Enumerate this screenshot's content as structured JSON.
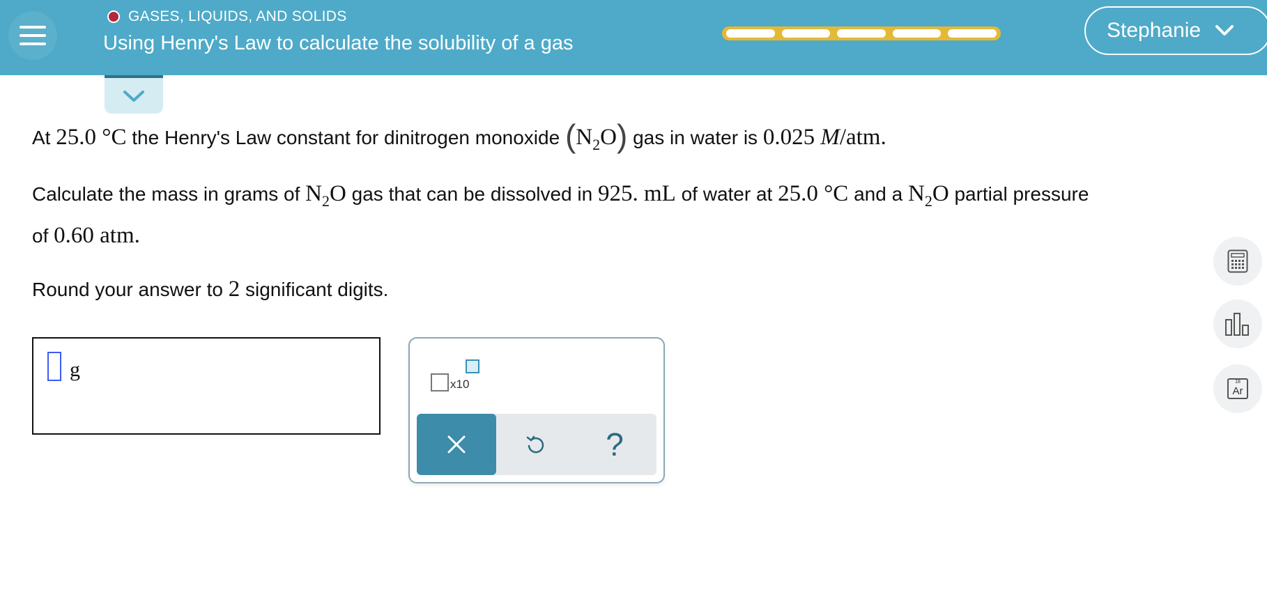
{
  "header": {
    "topic": "GASES, LIQUIDS, AND SOLIDS",
    "title": "Using Henry's Law to calculate the solubility of a gas",
    "user": "Stephanie",
    "progress_segments": 5,
    "colors": {
      "bar": "#4eaac8",
      "topic_dot": "#b3283e",
      "progress": "#e4b934"
    }
  },
  "question": {
    "p1": {
      "a": "At",
      "temp": "25.0 °C",
      "b": "the Henry's Law constant for dinitrogen monoxide",
      "n": "N",
      "n_sub": "2",
      "o": "O",
      "c": "gas in water is",
      "k_val": "0.025",
      "k_unit_m": "M",
      "k_unit_rest": "/atm."
    },
    "p2": {
      "a": "Calculate the mass in grams of",
      "n": "N",
      "n_sub": "2",
      "o": "O",
      "b": "gas that can be dissolved in",
      "volume": "925. mL",
      "c": "of water at",
      "temp": "25.0 °C",
      "d": "and a",
      "n2": "N",
      "n2_sub": "2",
      "o2": "O",
      "e": "partial pressure",
      "f": "of",
      "pressure": "0.60 atm."
    },
    "p3": {
      "a": "Round your answer to",
      "digits": "2",
      "b": "significant digits."
    }
  },
  "answer": {
    "value": "",
    "unit": "g"
  },
  "keypad": {
    "sci_label": "x10",
    "clear_icon": "close-icon",
    "undo_icon": "undo-icon",
    "help_label": "?"
  },
  "tools": {
    "calculator_icon": "calculator-icon",
    "data_icon": "bar-chart-icon",
    "periodic_number": "18",
    "periodic_symbol": "Ar"
  }
}
